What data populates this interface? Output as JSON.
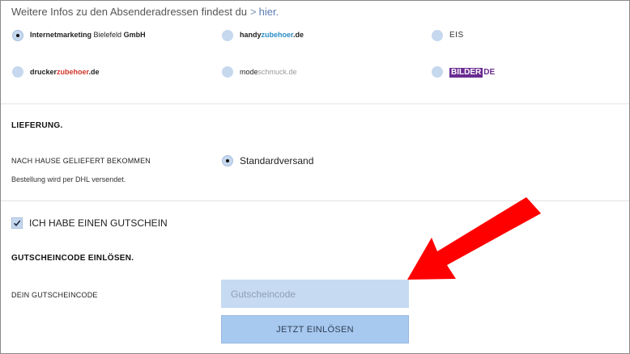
{
  "info": {
    "text": "Weitere Infos zu den Absenderadressen findest du",
    "chevron": ">",
    "link": "hier."
  },
  "senders": [
    {
      "part1": "Internetmarketing",
      "part2": " Bielefeld ",
      "part3": "GmbH",
      "selected": true
    },
    {
      "part1": "handy",
      "part2": "zubehoer",
      "part3": ".de",
      "selected": false
    },
    {
      "label": "EIS",
      "selected": false
    },
    {
      "part1": "drucker",
      "part2": "zubehoer",
      "part3": ".de",
      "selected": false
    },
    {
      "part1": "mode",
      "part2": "schmuck.de",
      "selected": false
    },
    {
      "part1": "BILDER",
      "part2": "DE",
      "selected": false
    }
  ],
  "lieferung": {
    "title": "LIEFERUNG.",
    "label": "NACH HAUSE GELIEFERT BEKOMMEN",
    "sub": "Bestellung wird per DHL versendet.",
    "option": "Standardversand",
    "option_selected": true
  },
  "gutschein": {
    "checkbox_label": "ICH HABE EINEN GUTSCHEIN",
    "checked": true,
    "title": "GUTSCHEINCODE EINLÖSEN.",
    "field_label": "DEIN GUTSCHEINCODE",
    "placeholder": "Gutscheincode",
    "button": "JETZT EINLÖSEN"
  },
  "colors": {
    "radio_fill": "#c6d8ee",
    "input_bg": "#c6daf2",
    "button_bg": "#a8c9ef",
    "arrow": "#ff0000",
    "brand_red": "#d0352b",
    "brand_blue": "#2a8cc5",
    "brand_purple": "#6a2c91"
  },
  "annotation": {
    "icon": "red-arrow-icon"
  }
}
